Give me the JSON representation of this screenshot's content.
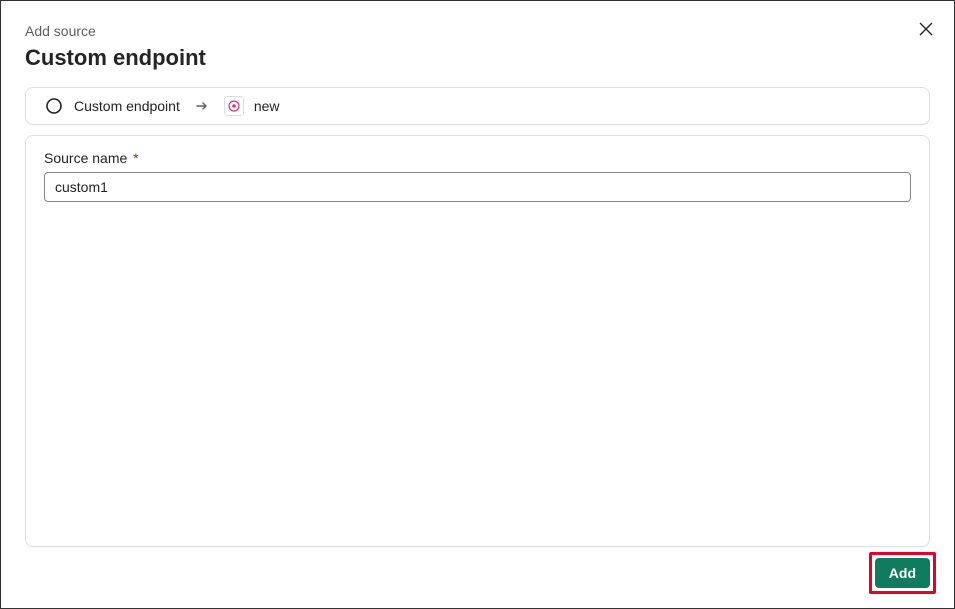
{
  "header": {
    "subtitle": "Add source",
    "title": "Custom endpoint"
  },
  "breadcrumb": {
    "step1": "Custom endpoint",
    "step2": "new"
  },
  "form": {
    "sourceName": {
      "label": "Source name",
      "required": "*",
      "value": "custom1"
    }
  },
  "footer": {
    "addLabel": "Add"
  }
}
